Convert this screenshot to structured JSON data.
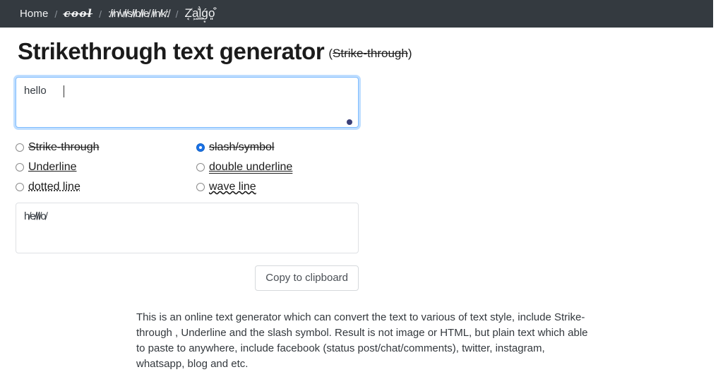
{
  "navbar": {
    "background_color": "#343a40",
    "separator": "/",
    "items": [
      {
        "label": "Home",
        "style": "plain"
      },
      {
        "label": "c̶o̶o̶l̶",
        "style": "script-strikethrough"
      },
      {
        "label": ":̸i̸n̸v̸i̸s̸i̸b̸l̸e̸ ̸i̸n̸k̸:̸",
        "style": "slash"
      },
      {
        "label": "Z͔͑a͖͐l͇̀ǵ͙o͈͒",
        "style": "zalgo"
      }
    ]
  },
  "header": {
    "title": "Strikethrough text generator",
    "title_suffix_open": "(",
    "title_suffix_text": "Strike-through",
    "title_suffix_close": ")"
  },
  "input": {
    "value": "hello",
    "placeholder": "",
    "focused": true
  },
  "options": {
    "selected": "slash/symbol",
    "items": [
      {
        "label": "Strike-through",
        "style": "strike",
        "checked": false,
        "column": "left"
      },
      {
        "label": "slash/symbol",
        "style": "slash",
        "checked": true,
        "column": "right"
      },
      {
        "label": "Underline ",
        "style": "underline",
        "checked": false,
        "column": "left"
      },
      {
        "label": "double underline",
        "style": "double",
        "checked": false,
        "column": "right"
      },
      {
        "label": "dotted line",
        "style": "dotted",
        "checked": false,
        "column": "left"
      },
      {
        "label": "wave line",
        "style": "wave",
        "checked": false,
        "column": "right"
      }
    ]
  },
  "output": {
    "value": "h̸e̸l̸l̸o̸",
    "placeholder": ""
  },
  "actions": {
    "copy_label": "Copy to clipboard"
  },
  "description": {
    "text": "This is an online text generator which can convert the text to various of text style, include Strike-through , Underline and the slash symbol. Result is not image or HTML, but plain text which able to paste to anywhere, include facebook (status post/chat/comments), twitter, instagram, whatsapp, blog and etc."
  },
  "colors": {
    "navbar": "#343a40",
    "accent_focus": "#80bdff",
    "radio_checked": "#1b72e8",
    "corner_dot": "#3b3f78",
    "page_background": "#ffffff"
  }
}
